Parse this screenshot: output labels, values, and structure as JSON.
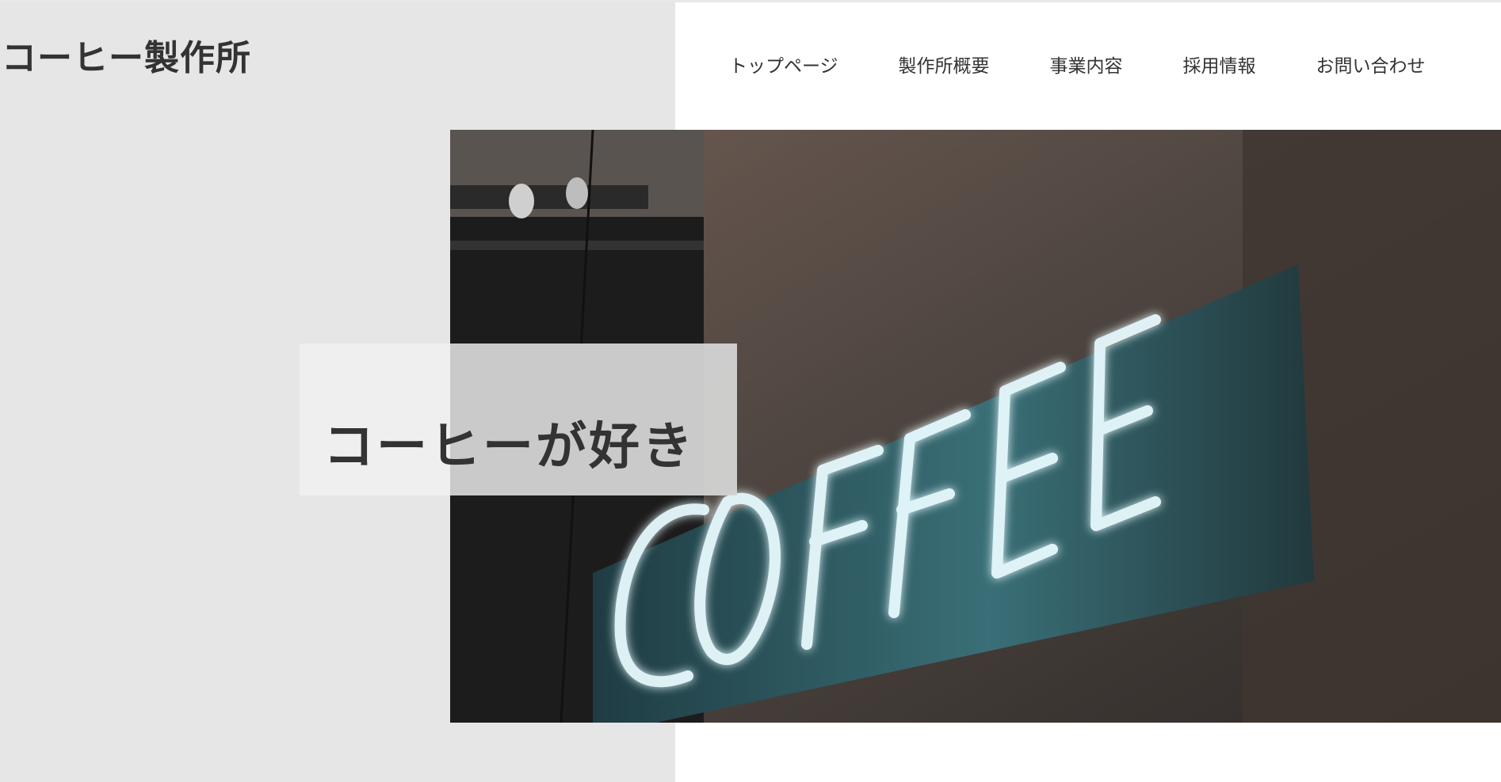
{
  "header": {
    "site_title": "コーヒー製作所",
    "nav": [
      {
        "label": "トップページ"
      },
      {
        "label": "製作所概要"
      },
      {
        "label": "事業内容"
      },
      {
        "label": "採用情報"
      },
      {
        "label": "お問い合わせ"
      }
    ]
  },
  "hero": {
    "catch_copy": "コーヒーが好き",
    "photo_sign_text": "COFFEE",
    "colors": {
      "left_panel": "#e6e6e6",
      "neon": "#e8fbff",
      "neon_glow": "#5fd0e6",
      "sign_board": "#2a4f55"
    }
  }
}
